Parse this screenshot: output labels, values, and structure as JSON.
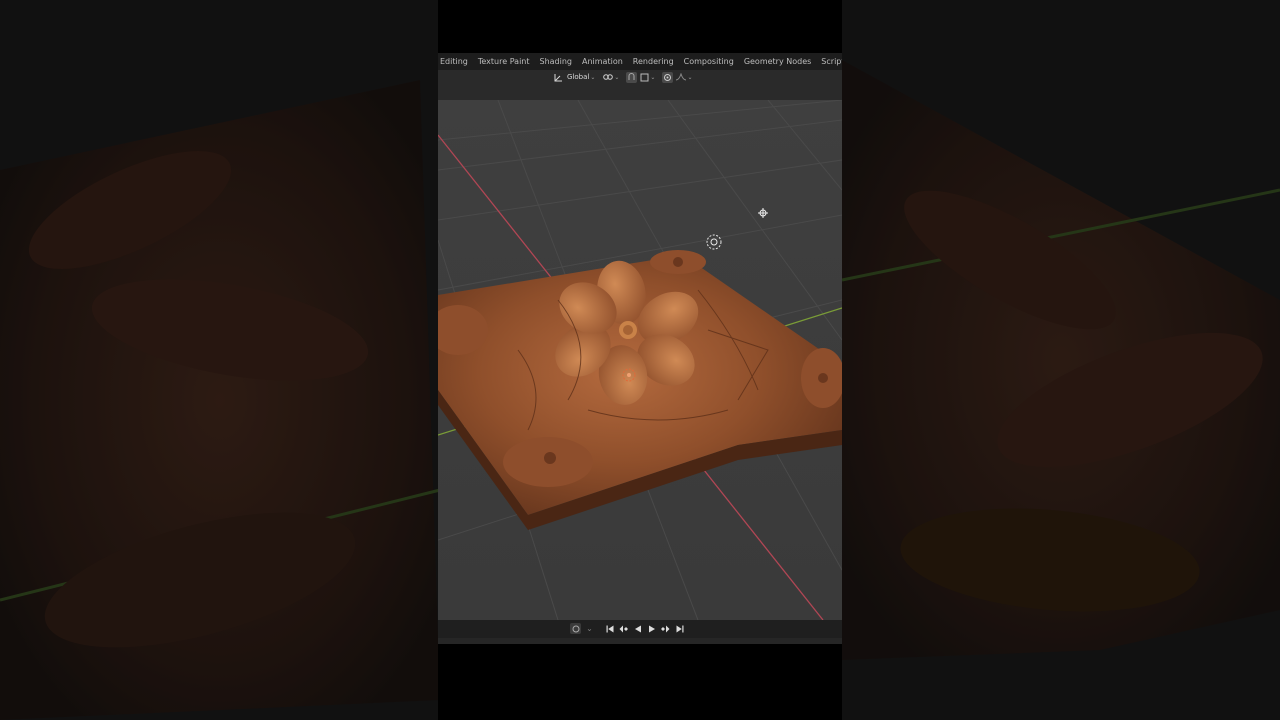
{
  "workspace_tabs": [
    {
      "label": "Editing"
    },
    {
      "label": "Texture Paint"
    },
    {
      "label": "Shading"
    },
    {
      "label": "Animation"
    },
    {
      "label": "Rendering"
    },
    {
      "label": "Compositing"
    },
    {
      "label": "Geometry Nodes"
    },
    {
      "label": "Scripting"
    }
  ],
  "add_workspace": "+",
  "header": {
    "transform_orientation": "Global"
  },
  "colors": {
    "x_axis": "#c24a57",
    "y_axis": "#7ea23a",
    "object": "#8a4b2a"
  },
  "icons": {
    "orientation": "transform-orientation-icon",
    "pivot": "pivot-link-icon",
    "snap": "snap-icon",
    "proportional": "proportional-editing-icon",
    "light": "light-gizmo-icon",
    "camera_pan": "move-gizmo-icon",
    "origin": "object-origin-icon"
  }
}
